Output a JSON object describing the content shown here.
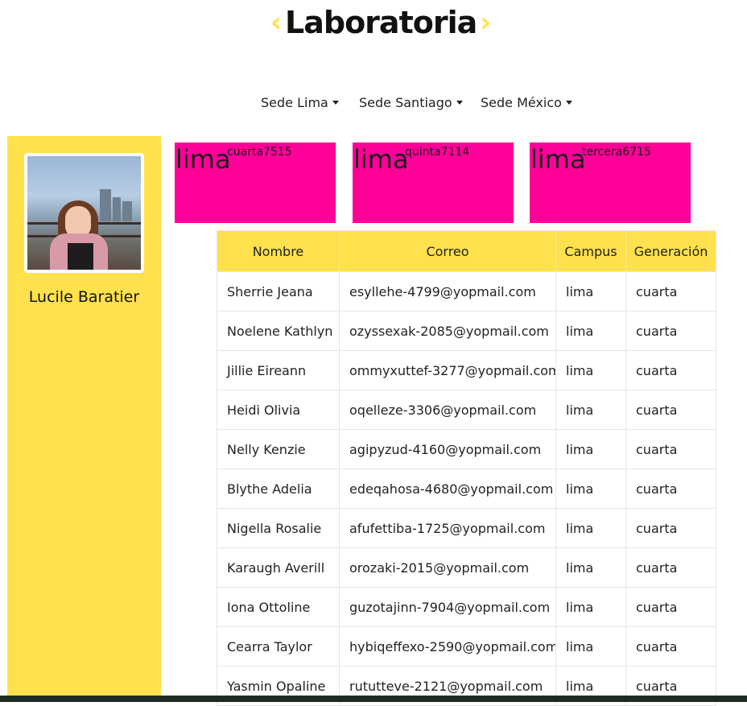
{
  "logo": {
    "left_chevron": "‹",
    "text": "Laboratoria",
    "right_chevron": "›"
  },
  "nav": [
    {
      "label": "Sede Lima"
    },
    {
      "label": "Sede Santiago"
    },
    {
      "label": "Sede México"
    }
  ],
  "profile": {
    "name": "Lucile Baratier"
  },
  "cards": [
    {
      "campus": "lima",
      "detail": "cuarta7515"
    },
    {
      "campus": "lima",
      "detail": "quinta7114"
    },
    {
      "campus": "lima",
      "detail": "tercera6715"
    }
  ],
  "table": {
    "headers": [
      "Nombre",
      "Correo",
      "Campus",
      "Generación"
    ],
    "rows": [
      [
        "Sherrie Jeana",
        "esyllehe-4799@yopmail.com",
        "lima",
        "cuarta"
      ],
      [
        "Noelene Kathlyn",
        "ozyssexak-2085@yopmail.com",
        "lima",
        "cuarta"
      ],
      [
        "Jillie Eireann",
        "ommyxuttef-3277@yopmail.com",
        "lima",
        "cuarta"
      ],
      [
        "Heidi Olivia",
        "oqelleze-3306@yopmail.com",
        "lima",
        "cuarta"
      ],
      [
        "Nelly Kenzie",
        "agipyzud-4160@yopmail.com",
        "lima",
        "cuarta"
      ],
      [
        "Blythe Adelia",
        "edeqahosa-4680@yopmail.com",
        "lima",
        "cuarta"
      ],
      [
        "Nigella Rosalie",
        "afufettiba-1725@yopmail.com",
        "lima",
        "cuarta"
      ],
      [
        "Karaugh Averill",
        "orozaki-2015@yopmail.com",
        "lima",
        "cuarta"
      ],
      [
        "Iona Ottoline",
        "guzotajinn-7904@yopmail.com",
        "lima",
        "cuarta"
      ],
      [
        "Cearra Taylor",
        "hybiqeffexo-2590@yopmail.com",
        "lima",
        "cuarta"
      ],
      [
        "Yasmin Opaline",
        "rututteve-2121@yopmail.com",
        "lima",
        "cuarta"
      ]
    ]
  },
  "colors": {
    "accent": "#ffe14d",
    "card": "#ff0099"
  }
}
